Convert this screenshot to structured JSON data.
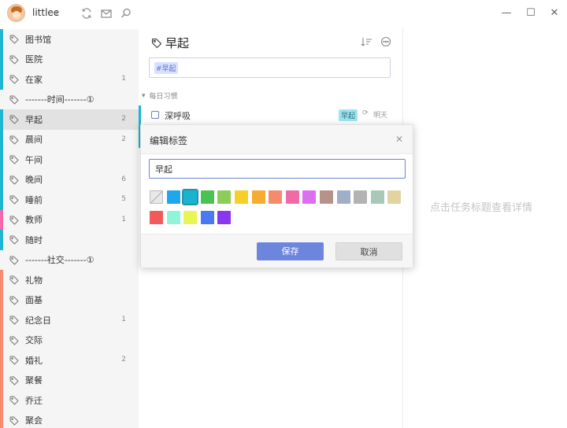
{
  "app": {
    "username": "littlee",
    "window_buttons": [
      "—",
      "☐",
      "✕"
    ]
  },
  "sidebar": {
    "items": [
      {
        "label": "图书馆",
        "count": "",
        "color": "#1eb6d2"
      },
      {
        "label": "医院",
        "count": "",
        "color": "#1eb6d2"
      },
      {
        "label": "在家",
        "count": "1",
        "color": "#1eb6d2"
      },
      {
        "label": "-------时间-------①",
        "count": "",
        "color": ""
      },
      {
        "label": "早起",
        "count": "2",
        "color": "#1eb6d2"
      },
      {
        "label": "晨间",
        "count": "2",
        "color": "#1eb6d2"
      },
      {
        "label": "午间",
        "count": "",
        "color": "#1eb6d2"
      },
      {
        "label": "晚间",
        "count": "6",
        "color": "#1eb6d2"
      },
      {
        "label": "睡前",
        "count": "5",
        "color": "#1eb6d2"
      },
      {
        "label": "教师",
        "count": "1",
        "color": "#f06aa8"
      },
      {
        "label": "随时",
        "count": "",
        "color": "#1eb6d2"
      },
      {
        "label": "-------社交-------①",
        "count": "",
        "color": ""
      },
      {
        "label": "礼物",
        "count": "",
        "color": "#f58a6e"
      },
      {
        "label": "面基",
        "count": "",
        "color": "#f58a6e"
      },
      {
        "label": "纪念日",
        "count": "1",
        "color": "#f58a6e"
      },
      {
        "label": "交际",
        "count": "",
        "color": "#f58a6e"
      },
      {
        "label": "婚礼",
        "count": "2",
        "color": "#f58a6e"
      },
      {
        "label": "聚餐",
        "count": "",
        "color": "#f58a6e"
      },
      {
        "label": "乔迁",
        "count": "",
        "color": "#f58a6e"
      },
      {
        "label": "聚会",
        "count": "",
        "color": "#f58a6e"
      }
    ],
    "active_index": 4
  },
  "main": {
    "title": "早起",
    "add_task_chip": "#早起",
    "section_header": "每日习惯",
    "task": {
      "text": "深呼吸",
      "badge": "早起",
      "due": "明天"
    }
  },
  "detail": {
    "hint": "点击任务标题查看详情"
  },
  "modal": {
    "title": "编辑标签",
    "input_value": "早起",
    "save_label": "保存",
    "cancel_label": "取消",
    "selected_color": "#1ab3cf",
    "colors_row1": [
      "none",
      "#1ea6ee",
      "#1ab3cf",
      "#4cc253",
      "#8ccd55",
      "#f7cf2a",
      "#f6ab31",
      "#f58a6e",
      "#f06aa8",
      "#dd6ef0",
      "#b69388",
      "#9faec9",
      "#b3b3b3",
      "#a8c8b8",
      "#e3d3a0"
    ],
    "colors_row2": [
      "#f2595a",
      "#8ef5d9",
      "#e8f552",
      "#4a79f0",
      "#8a35ee"
    ]
  }
}
